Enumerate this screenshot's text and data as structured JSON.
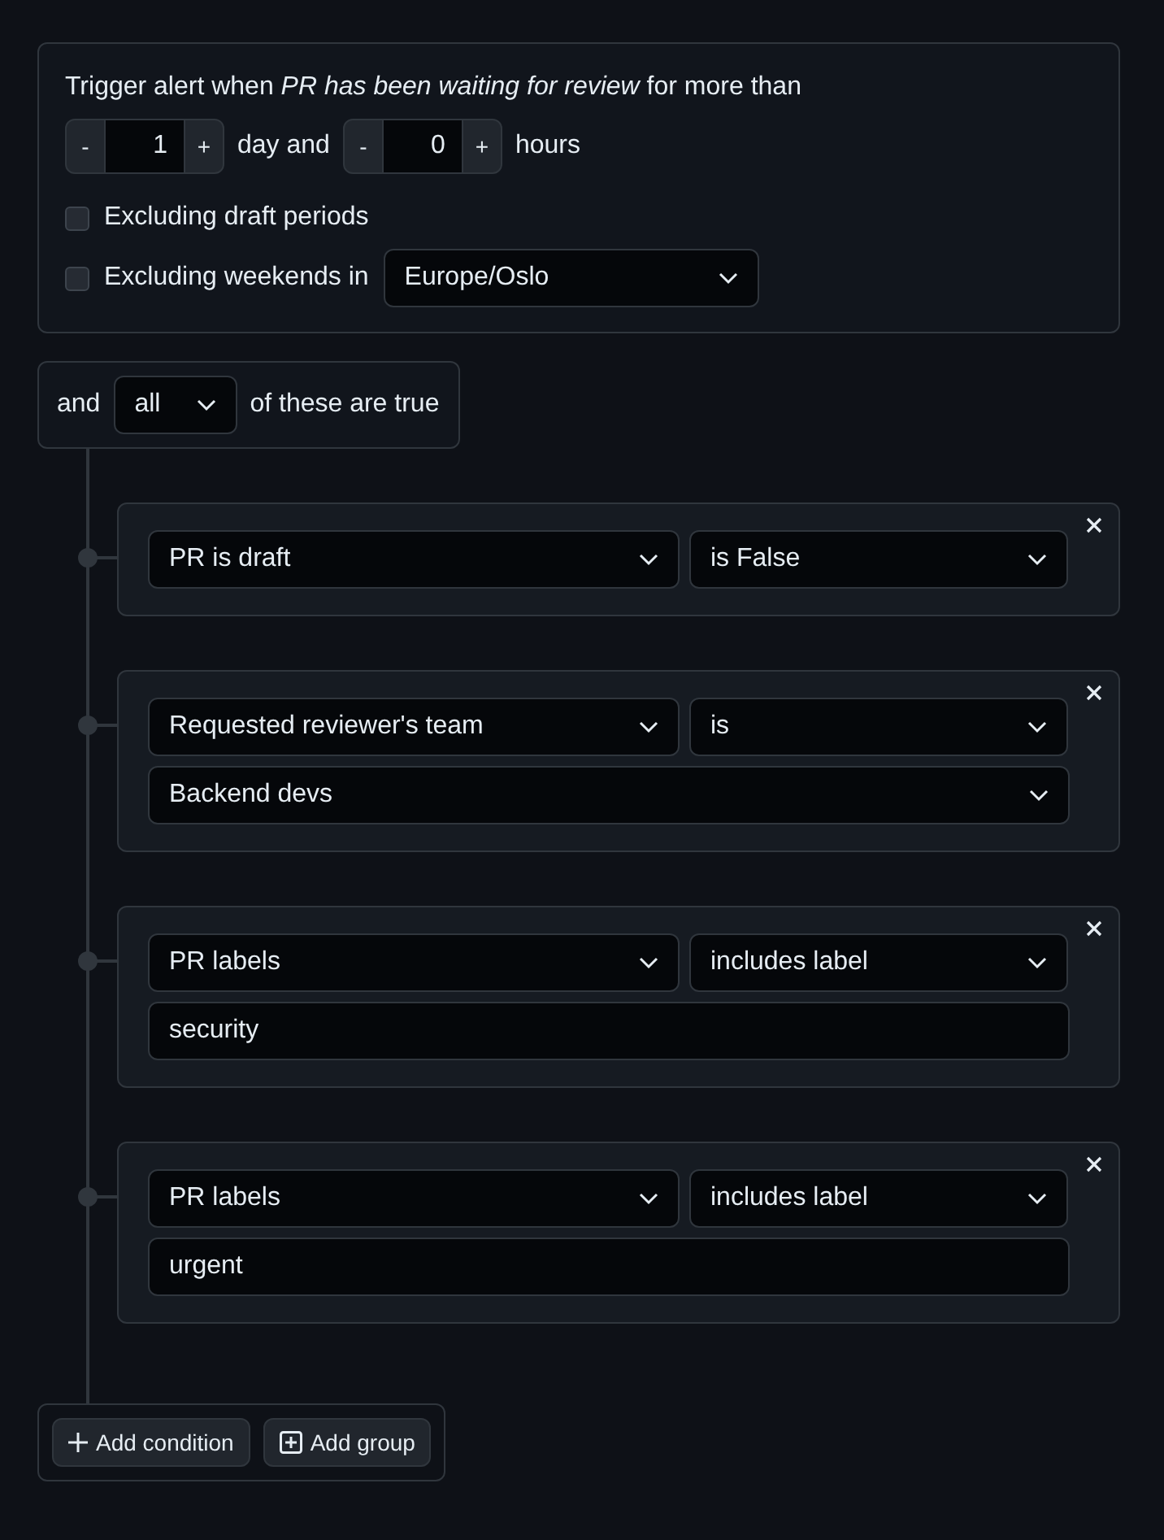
{
  "trigger": {
    "sentence": "Trigger alert when *PR has been waiting for review* for more than",
    "days": {
      "minus": "-",
      "value": "1",
      "plus": "+"
    },
    "days_label": "day and",
    "hours": {
      "minus": "-",
      "value": "0",
      "plus": "+"
    },
    "hours_label": "hours",
    "options": [
      {
        "label": "Excluding draft periods",
        "checked": false
      },
      {
        "label": "Excluding weekends in",
        "checked": false,
        "timezone": "Europe/Oslo"
      }
    ]
  },
  "group": {
    "prefix": "and",
    "quantifier": "all",
    "suffix": "of these are true"
  },
  "conditions": [
    {
      "kind": "plain",
      "field": "PR is draft",
      "operator": "is False"
    },
    {
      "kind": "select",
      "field": "Requested reviewer's team",
      "operator": "is",
      "value": "Backend devs"
    },
    {
      "kind": "text",
      "field": "PR labels",
      "operator": "includes label",
      "value": "security"
    },
    {
      "kind": "text",
      "field": "PR labels",
      "operator": "includes label",
      "value": "urgent"
    }
  ],
  "actions": [
    {
      "label": "Add condition",
      "kind": "plus"
    },
    {
      "label": "Add group",
      "kind": "box-plus"
    }
  ]
}
